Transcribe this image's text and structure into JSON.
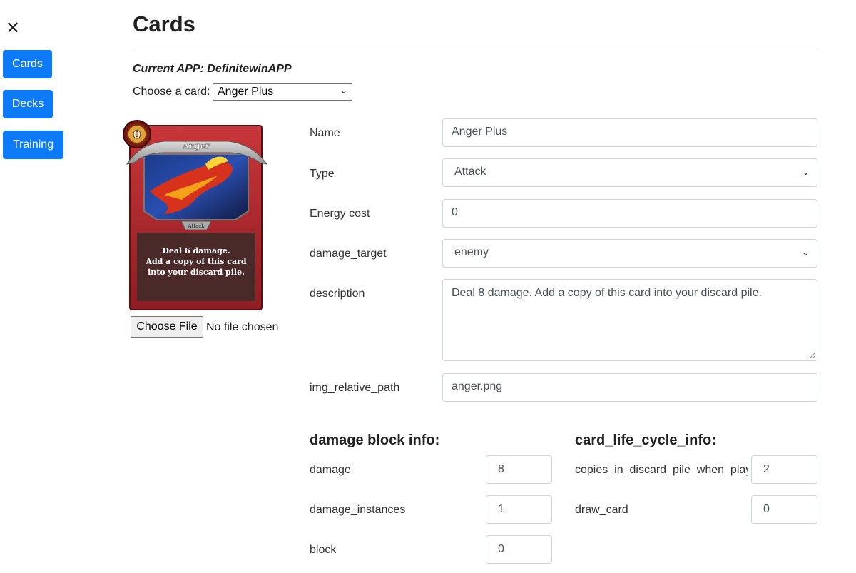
{
  "sidebar": {
    "close_icon": "close-icon",
    "items": [
      {
        "label": "Cards"
      },
      {
        "label": "Decks"
      },
      {
        "label": "Training"
      }
    ],
    "accent": "#0d7bf8"
  },
  "page": {
    "title": "Cards",
    "current_app": "Current APP: DefinitewinAPP",
    "choose_label": "Choose a card:",
    "selected_card": "Anger Plus"
  },
  "card_image": {
    "cost": "0",
    "name": "Anger",
    "type": "Attack",
    "text_lines": [
      "Deal 6 damage.",
      "Add a copy of this card",
      "into your discard pile."
    ]
  },
  "file_upload": {
    "button_label": "Choose File",
    "status": "No file chosen"
  },
  "form": {
    "name_label": "Name",
    "name_value": "Anger Plus",
    "type_label": "Type",
    "type_value": "Attack",
    "energy_label": "Energy cost",
    "energy_value": "0",
    "damage_target_label": "damage_target",
    "damage_target_value": "enemy",
    "description_label": "description",
    "description_value": "Deal 8 damage. Add a copy of this card into your discard pile.",
    "img_path_label": "img_relative_path",
    "img_path_value": "anger.png"
  },
  "damage_block": {
    "heading": "damage block info:",
    "damage_label": "damage",
    "damage_value": "8",
    "instances_label": "damage_instances",
    "instances_value": "1",
    "block_label": "block",
    "block_value": "0"
  },
  "life_cycle": {
    "heading": "card_life_cycle_info:",
    "copies_label": "copies_in_discard_pile_when_played",
    "copies_value": "2",
    "draw_label": "draw_card",
    "draw_value": "0"
  }
}
